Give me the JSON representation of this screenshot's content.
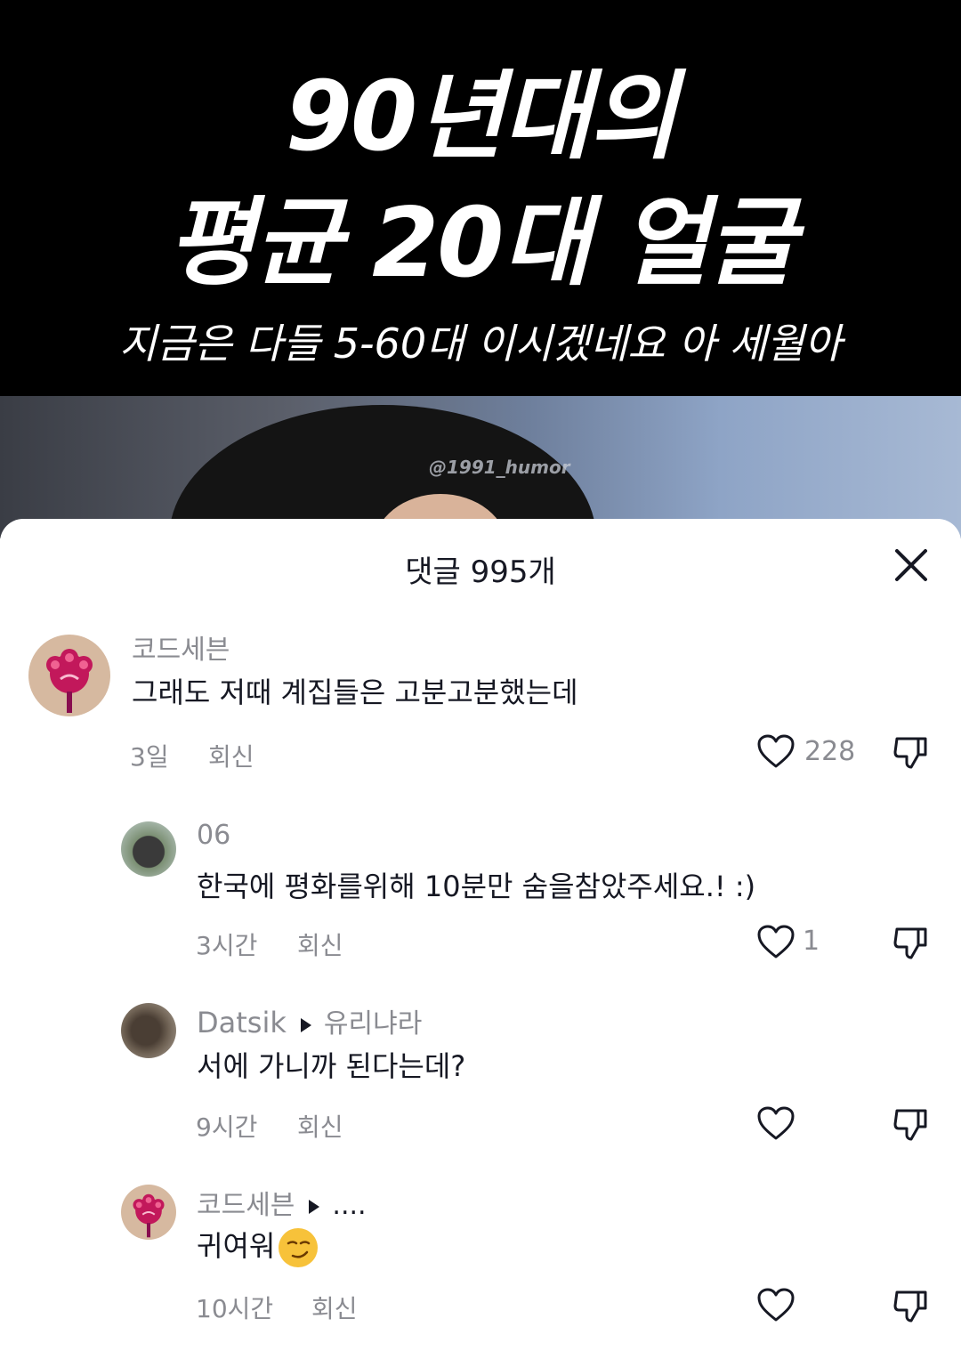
{
  "video": {
    "title_line1": "90년대의",
    "title_line2": "평균 20대 얼굴",
    "subtitle": "지금은 다들 5-60대 이시겠네요 아 세월아",
    "watermark": "@1991_humor"
  },
  "sheet": {
    "title": "댓글 995개"
  },
  "comments": [
    {
      "username": "코드세븐",
      "text": "그래도 저때 계집들은 고분고분했는데",
      "time": "3일",
      "reply": "회신",
      "likes": "228"
    },
    {
      "username": "06",
      "text": "한국에 평화를위해 10분만 숨을참았주세요.! :)",
      "time": "3시간",
      "reply": "회신",
      "likes": "1"
    },
    {
      "username": "Datsik",
      "reply_to": "유리냐라",
      "text": "서에 가니까 된다는데?",
      "time": "9시간",
      "reply": "회신",
      "likes": ""
    },
    {
      "username": "코드세븐",
      "reply_to": "....",
      "text": "귀여워",
      "time": "10시간",
      "reply": "회신",
      "likes": "",
      "emoji": "smirk-emoji"
    }
  ],
  "icons": {
    "close": "close-icon",
    "like": "heart-icon",
    "dislike": "thumbs-down-icon",
    "reply_arrow": "reply-arrow-icon"
  },
  "colors": {
    "text_primary": "#161823",
    "text_secondary": "#8a8b91",
    "banner": "#000000"
  }
}
